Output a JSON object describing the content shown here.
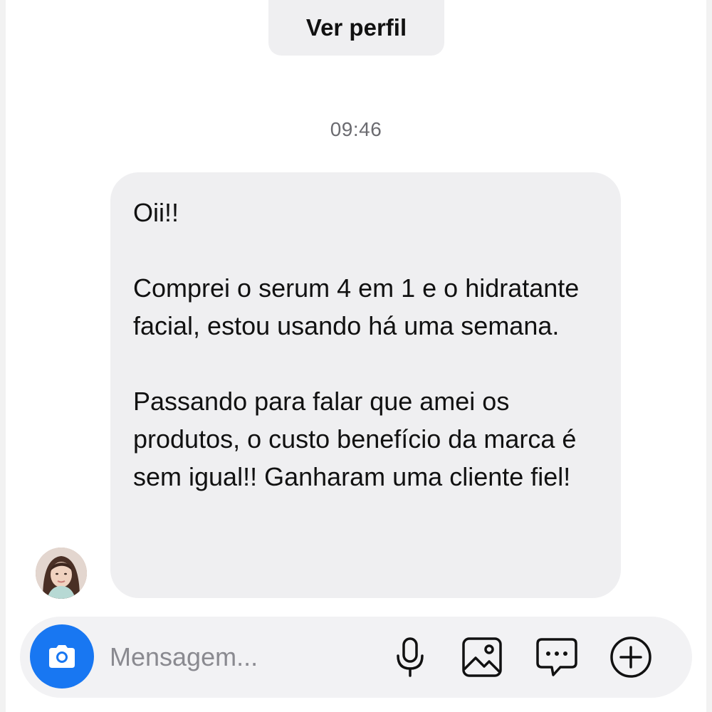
{
  "header": {
    "view_profile_label": "Ver perfil"
  },
  "thread": {
    "timestamp": "09:46",
    "message": {
      "paragraphs": [
        "Oii!!",
        "Comprei o serum 4 em 1 e o hidratante facial, estou usando há uma semana.",
        "Passando para falar que amei os produtos, o custo benefício da marca é sem igual!! Ganharam uma cliente fiel!"
      ]
    },
    "sender_avatar_icon": "user-avatar-photo"
  },
  "composer": {
    "placeholder": "Mensagem...",
    "camera_icon": "camera-icon",
    "tools": [
      "microphone-icon",
      "image-icon",
      "chat-bubble-icon",
      "plus-circle-icon"
    ]
  },
  "colors": {
    "accent": "#1877f2",
    "bubble_bg": "#efeff1",
    "muted_text": "#6b6b70",
    "placeholder_text": "#8a8a90"
  }
}
